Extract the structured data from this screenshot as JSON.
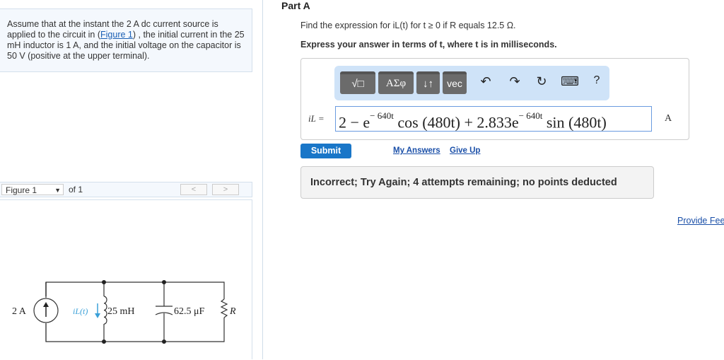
{
  "problem": {
    "text_before": "Assume that at the instant the 2 A dc current source is applied to the circuit in (",
    "figure_link": "Figure 1",
    "text_after": ") , the initial current in the 25 mH inductor is 1 A, and the initial voltage on the capacitor is 50 V (positive at the upper terminal)."
  },
  "figure": {
    "selected": "Figure 1",
    "of": "of 1",
    "prev": "<",
    "next": ">",
    "circuit": {
      "source": "2 A",
      "current_label": "iL(t)",
      "inductor": "25 mH",
      "capacitor": "62.5 μF",
      "resistor": "R"
    }
  },
  "part": {
    "title": "Part A",
    "question": "Find the expression for iL(t) for t ≥ 0 if R equals 12.5 Ω.",
    "instruction": "Express your answer in terms of t, where t is in milliseconds."
  },
  "toolbar": {
    "templates": "√□",
    "greek": "ΑΣφ",
    "arrows": "↓↑",
    "vec": "vec",
    "undo": "↶",
    "redo": "↷",
    "reset": "↻",
    "keyboard": "⌨",
    "help": "?"
  },
  "answer": {
    "label": "iL =",
    "p1": "2 − e",
    "e1": "− 640t",
    "p2": " cos (480t) + 2.833e",
    "e2": "− 640t",
    "p3": " sin (480t)",
    "unit": "A"
  },
  "actions": {
    "submit": "Submit",
    "my_answers": "My Answers",
    "give_up": "Give Up"
  },
  "feedback": "Incorrect; Try Again; 4 attempts remaining; no points deducted",
  "provide_feedback": "Provide Feedback"
}
